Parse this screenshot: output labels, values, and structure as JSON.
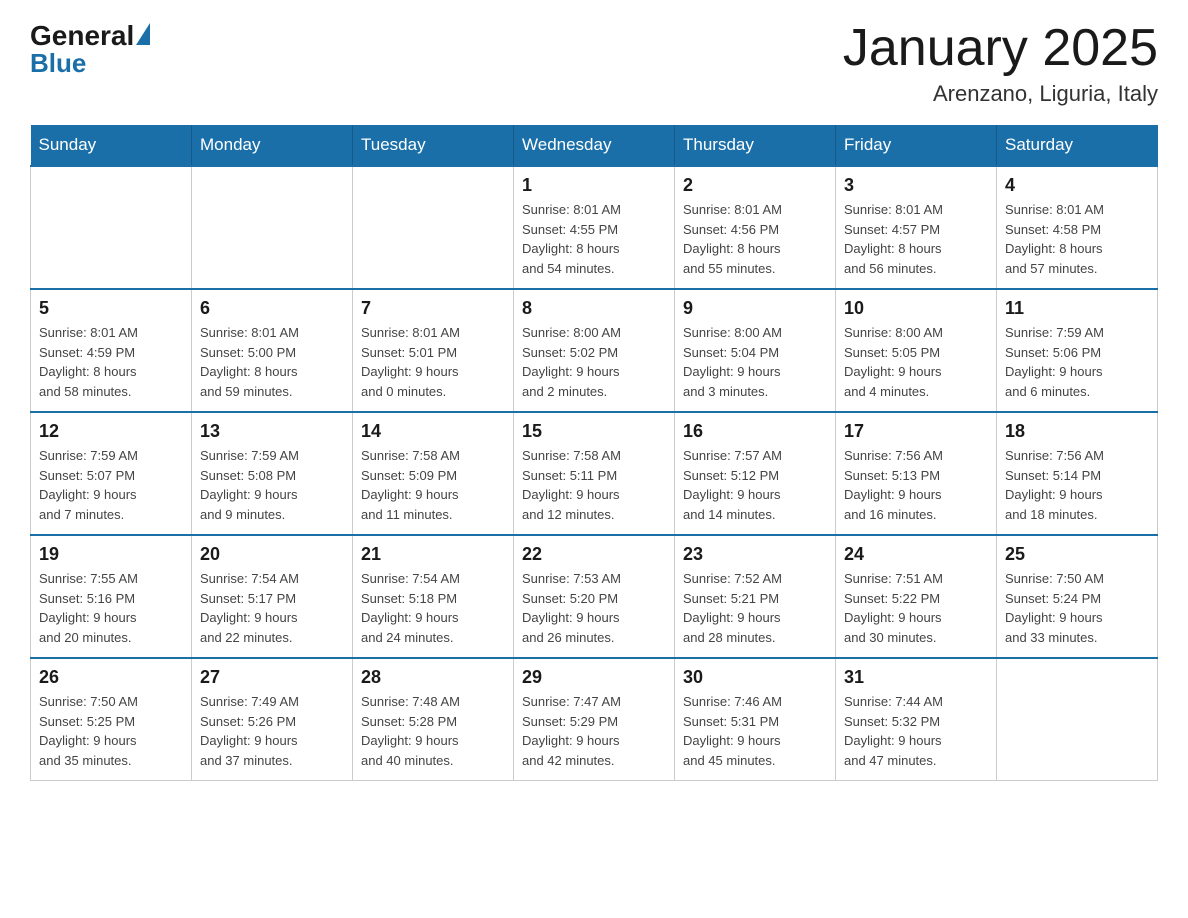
{
  "logo": {
    "general": "General",
    "blue": "Blue"
  },
  "header": {
    "title": "January 2025",
    "subtitle": "Arenzano, Liguria, Italy"
  },
  "days_of_week": [
    "Sunday",
    "Monday",
    "Tuesday",
    "Wednesday",
    "Thursday",
    "Friday",
    "Saturday"
  ],
  "weeks": [
    [
      {
        "day": "",
        "info": ""
      },
      {
        "day": "",
        "info": ""
      },
      {
        "day": "",
        "info": ""
      },
      {
        "day": "1",
        "info": "Sunrise: 8:01 AM\nSunset: 4:55 PM\nDaylight: 8 hours\nand 54 minutes."
      },
      {
        "day": "2",
        "info": "Sunrise: 8:01 AM\nSunset: 4:56 PM\nDaylight: 8 hours\nand 55 minutes."
      },
      {
        "day": "3",
        "info": "Sunrise: 8:01 AM\nSunset: 4:57 PM\nDaylight: 8 hours\nand 56 minutes."
      },
      {
        "day": "4",
        "info": "Sunrise: 8:01 AM\nSunset: 4:58 PM\nDaylight: 8 hours\nand 57 minutes."
      }
    ],
    [
      {
        "day": "5",
        "info": "Sunrise: 8:01 AM\nSunset: 4:59 PM\nDaylight: 8 hours\nand 58 minutes."
      },
      {
        "day": "6",
        "info": "Sunrise: 8:01 AM\nSunset: 5:00 PM\nDaylight: 8 hours\nand 59 minutes."
      },
      {
        "day": "7",
        "info": "Sunrise: 8:01 AM\nSunset: 5:01 PM\nDaylight: 9 hours\nand 0 minutes."
      },
      {
        "day": "8",
        "info": "Sunrise: 8:00 AM\nSunset: 5:02 PM\nDaylight: 9 hours\nand 2 minutes."
      },
      {
        "day": "9",
        "info": "Sunrise: 8:00 AM\nSunset: 5:04 PM\nDaylight: 9 hours\nand 3 minutes."
      },
      {
        "day": "10",
        "info": "Sunrise: 8:00 AM\nSunset: 5:05 PM\nDaylight: 9 hours\nand 4 minutes."
      },
      {
        "day": "11",
        "info": "Sunrise: 7:59 AM\nSunset: 5:06 PM\nDaylight: 9 hours\nand 6 minutes."
      }
    ],
    [
      {
        "day": "12",
        "info": "Sunrise: 7:59 AM\nSunset: 5:07 PM\nDaylight: 9 hours\nand 7 minutes."
      },
      {
        "day": "13",
        "info": "Sunrise: 7:59 AM\nSunset: 5:08 PM\nDaylight: 9 hours\nand 9 minutes."
      },
      {
        "day": "14",
        "info": "Sunrise: 7:58 AM\nSunset: 5:09 PM\nDaylight: 9 hours\nand 11 minutes."
      },
      {
        "day": "15",
        "info": "Sunrise: 7:58 AM\nSunset: 5:11 PM\nDaylight: 9 hours\nand 12 minutes."
      },
      {
        "day": "16",
        "info": "Sunrise: 7:57 AM\nSunset: 5:12 PM\nDaylight: 9 hours\nand 14 minutes."
      },
      {
        "day": "17",
        "info": "Sunrise: 7:56 AM\nSunset: 5:13 PM\nDaylight: 9 hours\nand 16 minutes."
      },
      {
        "day": "18",
        "info": "Sunrise: 7:56 AM\nSunset: 5:14 PM\nDaylight: 9 hours\nand 18 minutes."
      }
    ],
    [
      {
        "day": "19",
        "info": "Sunrise: 7:55 AM\nSunset: 5:16 PM\nDaylight: 9 hours\nand 20 minutes."
      },
      {
        "day": "20",
        "info": "Sunrise: 7:54 AM\nSunset: 5:17 PM\nDaylight: 9 hours\nand 22 minutes."
      },
      {
        "day": "21",
        "info": "Sunrise: 7:54 AM\nSunset: 5:18 PM\nDaylight: 9 hours\nand 24 minutes."
      },
      {
        "day": "22",
        "info": "Sunrise: 7:53 AM\nSunset: 5:20 PM\nDaylight: 9 hours\nand 26 minutes."
      },
      {
        "day": "23",
        "info": "Sunrise: 7:52 AM\nSunset: 5:21 PM\nDaylight: 9 hours\nand 28 minutes."
      },
      {
        "day": "24",
        "info": "Sunrise: 7:51 AM\nSunset: 5:22 PM\nDaylight: 9 hours\nand 30 minutes."
      },
      {
        "day": "25",
        "info": "Sunrise: 7:50 AM\nSunset: 5:24 PM\nDaylight: 9 hours\nand 33 minutes."
      }
    ],
    [
      {
        "day": "26",
        "info": "Sunrise: 7:50 AM\nSunset: 5:25 PM\nDaylight: 9 hours\nand 35 minutes."
      },
      {
        "day": "27",
        "info": "Sunrise: 7:49 AM\nSunset: 5:26 PM\nDaylight: 9 hours\nand 37 minutes."
      },
      {
        "day": "28",
        "info": "Sunrise: 7:48 AM\nSunset: 5:28 PM\nDaylight: 9 hours\nand 40 minutes."
      },
      {
        "day": "29",
        "info": "Sunrise: 7:47 AM\nSunset: 5:29 PM\nDaylight: 9 hours\nand 42 minutes."
      },
      {
        "day": "30",
        "info": "Sunrise: 7:46 AM\nSunset: 5:31 PM\nDaylight: 9 hours\nand 45 minutes."
      },
      {
        "day": "31",
        "info": "Sunrise: 7:44 AM\nSunset: 5:32 PM\nDaylight: 9 hours\nand 47 minutes."
      },
      {
        "day": "",
        "info": ""
      }
    ]
  ]
}
